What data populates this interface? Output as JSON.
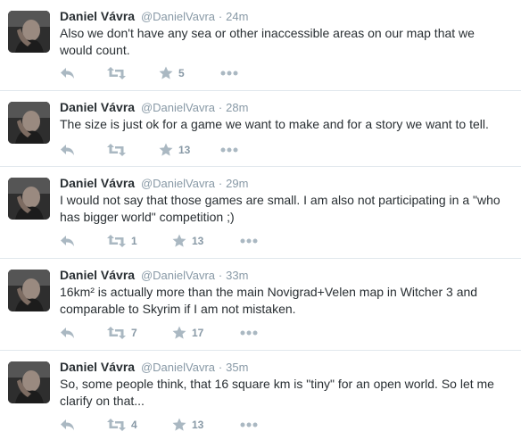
{
  "tweets": [
    {
      "name": "Daniel Vávra",
      "handle": "@DanielVavra",
      "separator": "·",
      "time": "24m",
      "text": "Also we don't have any sea or other inaccessible areas on our map that we would count.",
      "retweets": "",
      "favorites": "5"
    },
    {
      "name": "Daniel Vávra",
      "handle": "@DanielVavra",
      "separator": "·",
      "time": "28m",
      "text": "The size is just ok for a game we want to make and for a story we want to tell.",
      "retweets": "",
      "favorites": "13"
    },
    {
      "name": "Daniel Vávra",
      "handle": "@DanielVavra",
      "separator": "·",
      "time": "29m",
      "text": "I would not say that those games are small. I am also not participating in a \"who has bigger world\" competition ;)",
      "retweets": "1",
      "favorites": "13"
    },
    {
      "name": "Daniel Vávra",
      "handle": "@DanielVavra",
      "separator": "·",
      "time": "33m",
      "text": "16km² is actually more than the main Novigrad+Velen map in Witcher 3 and comparable to Skyrim if I am not mistaken.",
      "retweets": "7",
      "favorites": "17"
    },
    {
      "name": "Daniel Vávra",
      "handle": "@DanielVavra",
      "separator": "·",
      "time": "35m",
      "text": "So, some people think, that 16 square km is \"tiny\" for an open world. So let me clarify on that...",
      "retweets": "4",
      "favorites": "13"
    }
  ],
  "icons": {
    "reply": "reply-icon",
    "retweet": "retweet-icon",
    "favorite": "star-icon",
    "more": "more-icon"
  },
  "colors": {
    "icon": "#aab8c2",
    "count": "#8899a6",
    "meta": "#8899a6",
    "text": "#292f33",
    "divider": "#e1e8ed"
  }
}
